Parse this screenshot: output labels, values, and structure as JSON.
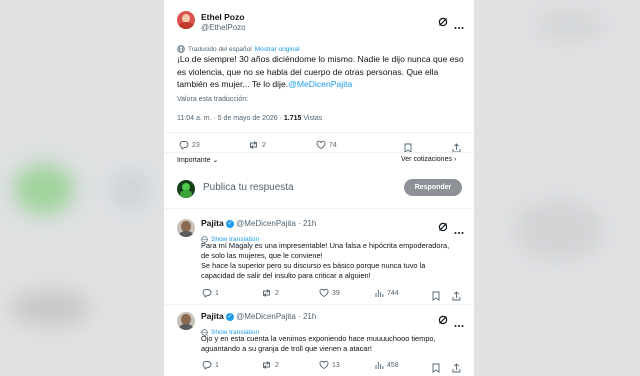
{
  "main_post": {
    "author_name": "Ethel Pozo",
    "author_handle": "@EthelPozo",
    "translated_note": "Traducido del español",
    "show_original": "Mostrar original",
    "text": "¡Lo de siempre! 30 años diciéndome lo mismo. Nadie le dijo nunca que eso es violencia, que no se habla del cuerpo de otras personas. Que ella también es mujer... Te lo dije.",
    "mention": "@MeDicenPajita",
    "rate_translation": "Valora esta traducción:",
    "timestamp": "11:04 a. m. · 5 de mayo de 2026 · ",
    "views_count": "1.715",
    "views_label": "Vistas",
    "replies": "23",
    "reposts": "2",
    "likes": "74",
    "important_label": "Importante",
    "quotes_label": "Ver cotizaciones"
  },
  "composer": {
    "placeholder": "Publica tu respuesta",
    "button": "Responder"
  },
  "replies": [
    {
      "name": "Pajita",
      "handle": "@MeDicenPajita",
      "time": "· 21h",
      "show_translation": "Show translation",
      "lines": [
        "Para mí Magaly es una impresentable! Una falsa e hipócrita empoderadora,",
        "de solo las mujeres, que le conviene!",
        "Se hace la superior pero su discurso es básico porque nunca tuvo la",
        "capacidad de salir del insulto para criticar a alguien!"
      ],
      "replies": "1",
      "reposts": "2",
      "likes": "39",
      "views": "744"
    },
    {
      "name": "Pajita",
      "handle": "@MeDicenPajita",
      "time": "· 21h",
      "show_translation": "Show translation",
      "lines": [
        "Ojo y en esta cuenta la venimos exponiendo hace muuuuchooo tiempo,",
        "aguantando a su granja de troll que vienen a atacar!"
      ],
      "replies": "1",
      "reposts": "2",
      "likes": "13",
      "views": "458"
    }
  ],
  "colors": {
    "accent": "#1d9bf0",
    "text": "#0f1419",
    "muted": "#536471",
    "button_disabled": "#8e9296"
  }
}
